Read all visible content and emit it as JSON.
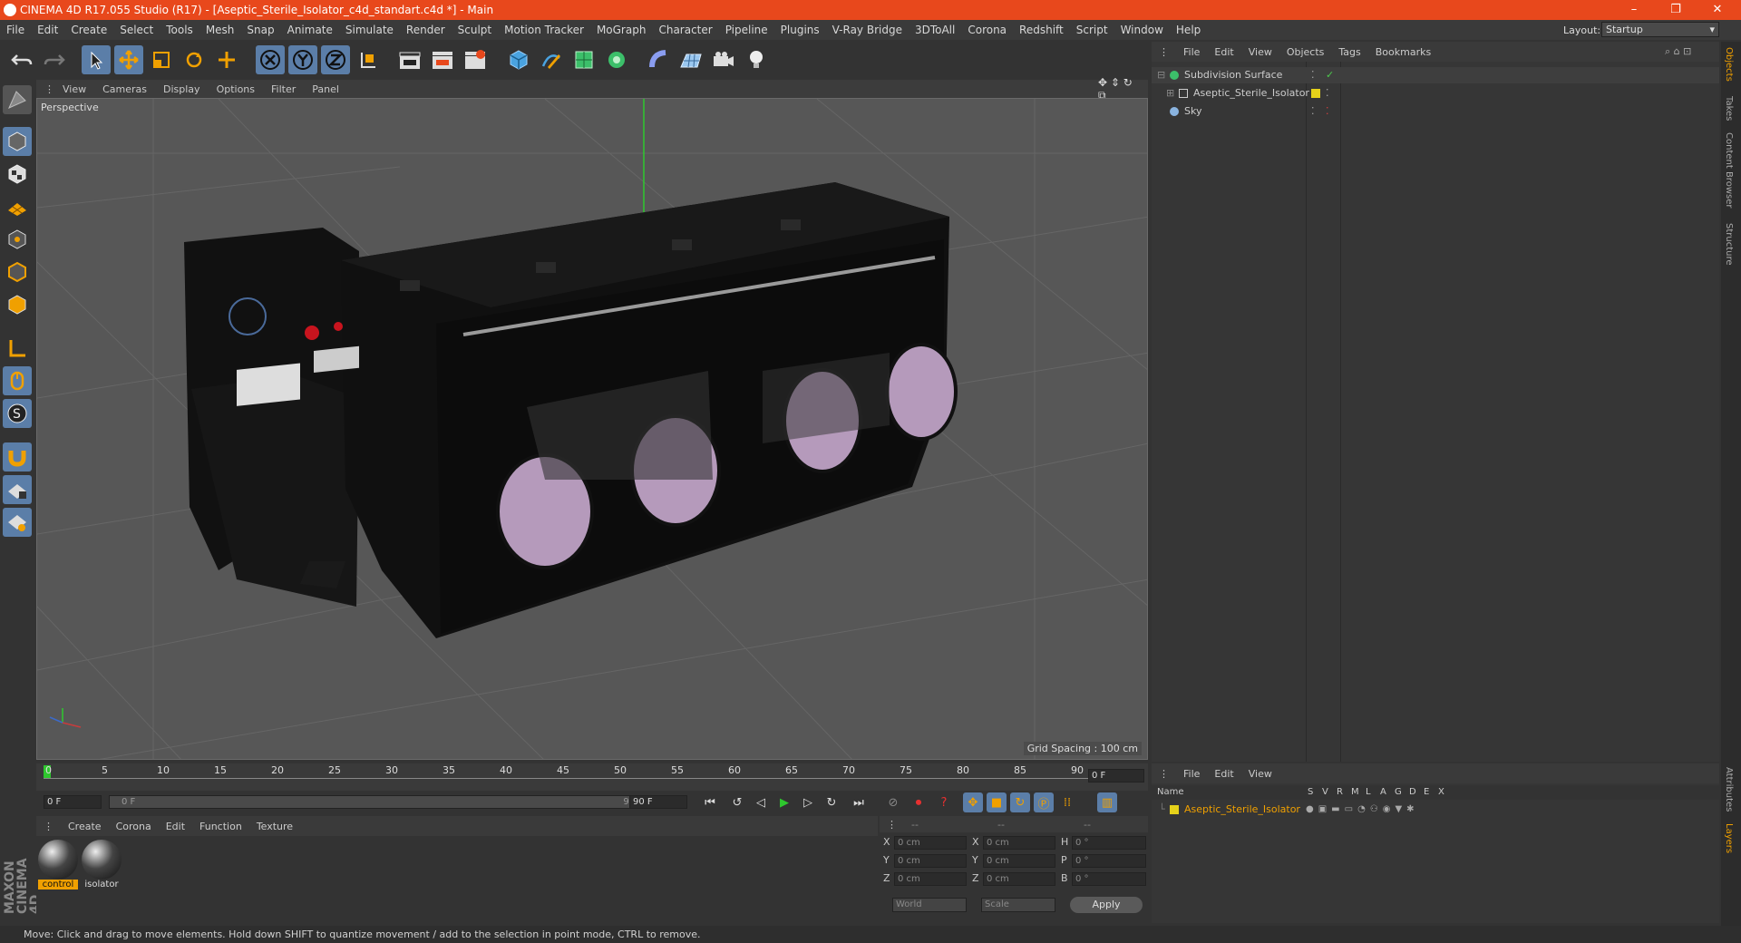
{
  "title": "CINEMA 4D R17.055 Studio (R17) - [Aseptic_Sterile_Isolator_c4d_standart.c4d *] - Main",
  "window_controls": {
    "minimize": "–",
    "restore": "❐",
    "close": "✕"
  },
  "menu": [
    "File",
    "Edit",
    "Create",
    "Select",
    "Tools",
    "Mesh",
    "Snap",
    "Animate",
    "Simulate",
    "Render",
    "Sculpt",
    "Motion Tracker",
    "MoGraph",
    "Character",
    "Pipeline",
    "Plugins",
    "V-Ray Bridge",
    "3DToAll",
    "Corona",
    "Redshift",
    "Script",
    "Window",
    "Help"
  ],
  "layout": {
    "label": "Layout:",
    "value": "Startup"
  },
  "viewport": {
    "menu": [
      "View",
      "Cameras",
      "Display",
      "Options",
      "Filter",
      "Panel"
    ],
    "camera_label": "Perspective",
    "grid_spacing": "Grid Spacing : 100 cm"
  },
  "timeline": {
    "ticks": [
      "0",
      "5",
      "10",
      "15",
      "20",
      "25",
      "30",
      "35",
      "40",
      "45",
      "50",
      "55",
      "60",
      "65",
      "70",
      "75",
      "80",
      "85",
      "90"
    ],
    "current_frame": "0 F",
    "start_field": "0 F",
    "range_left": "0 F",
    "range_right": "90 F",
    "end_field": "90 F"
  },
  "material_manager": {
    "menu": [
      "Create",
      "Corona",
      "Edit",
      "Function",
      "Texture"
    ],
    "materials": [
      {
        "name": "control",
        "selected": true
      },
      {
        "name": "isolator",
        "selected": false
      }
    ]
  },
  "coordinates": {
    "header": [
      "--",
      "--",
      "--"
    ],
    "rows": [
      {
        "a": "X",
        "av": "0 cm",
        "b": "X",
        "bv": "0 cm",
        "c": "H",
        "cv": "0 °"
      },
      {
        "a": "Y",
        "av": "0 cm",
        "b": "Y",
        "bv": "0 cm",
        "c": "P",
        "cv": "0 °"
      },
      {
        "a": "Z",
        "av": "0 cm",
        "b": "Z",
        "bv": "0 cm",
        "c": "B",
        "cv": "0 °"
      }
    ],
    "mode1": "World",
    "mode2": "Scale",
    "apply": "Apply"
  },
  "object_manager": {
    "menu": [
      "File",
      "Edit",
      "View",
      "Objects",
      "Tags",
      "Bookmarks"
    ],
    "objects": [
      {
        "name": "Subdivision Surface",
        "indent": 0
      },
      {
        "name": "Aseptic_Sterile_Isolator",
        "indent": 1
      },
      {
        "name": "Sky",
        "indent": 0
      }
    ]
  },
  "layer_manager": {
    "menu": [
      "File",
      "Edit",
      "View"
    ],
    "columns": [
      "Name",
      "S",
      "V",
      "R",
      "M",
      "L",
      "A",
      "G",
      "D",
      "E",
      "X"
    ],
    "layers": [
      {
        "name": "Aseptic_Sterile_Isolator",
        "color": "#e6d21a"
      }
    ]
  },
  "right_tabs": [
    "Objects",
    "Takes",
    "Content Browser",
    "Structure",
    "Attributes",
    "Layers"
  ],
  "brand": "MAXON CINEMA 4D",
  "status": "Move: Click and drag to move elements. Hold down SHIFT to quantize movement / add to the selection in point mode, CTRL to remove.",
  "colors": {
    "accent": "#e8481c",
    "selection": "#f0a000",
    "x_axis": "#c83c3c",
    "y_axis": "#4cc84c",
    "layer": "#e6d21a"
  }
}
